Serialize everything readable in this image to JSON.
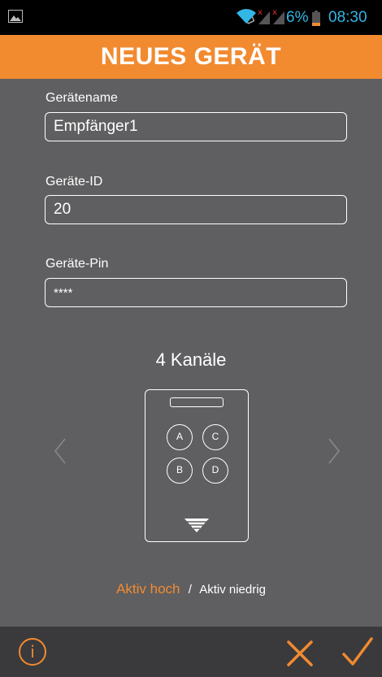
{
  "status_bar": {
    "battery_percent": "6%",
    "time": "08:30",
    "icons": [
      "image-icon",
      "vibrate-icon",
      "wifi-icon",
      "signal-no-sim-icon",
      "signal-no-sim-icon",
      "battery-low-icon"
    ],
    "accent_color": "#33b5e5"
  },
  "header": {
    "title": "NEUES GERÄT",
    "color": "#f28a30"
  },
  "form": {
    "name": {
      "label": "Gerätename",
      "value": "Empfänger1"
    },
    "id": {
      "label": "Geräte-ID",
      "value": "20"
    },
    "pin": {
      "label": "Geräte-Pin",
      "value": "****"
    }
  },
  "device": {
    "channels_label": "4 Kanäle",
    "buttons": [
      "A",
      "C",
      "B",
      "D"
    ]
  },
  "mode": {
    "active_high": "Aktiv hoch",
    "separator": "/",
    "active_low": "Aktiv niedrig",
    "selected": "Aktiv hoch"
  },
  "bottom_bar": {
    "info_label": "i",
    "icons": [
      "info-icon",
      "cancel-icon",
      "confirm-icon"
    ]
  }
}
